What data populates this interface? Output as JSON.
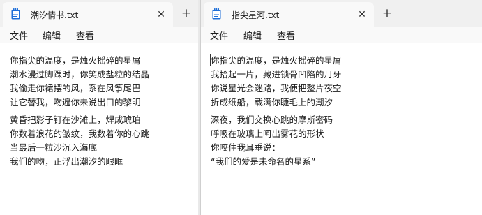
{
  "left_window": {
    "tab": {
      "title": "潮汐情书.txt"
    },
    "menu": [
      "文件",
      "编辑",
      "查看"
    ],
    "stanza1": [
      "你指尖的温度，是烛火摇碎的星屑",
      "潮水漫过脚踝时，你笑成盐粒的结晶",
      "我偷走你裙摆的风，系在风筝尾巴",
      "让它替我，吻遍你未说出口的黎明"
    ],
    "stanza2": [
      "黄昏把影子钉在沙滩上，焊成琥珀",
      "你数着浪花的皱纹，我数着你的心跳",
      "当最后一粒沙沉入海底",
      "我们的吻，正浮出潮汐的眼眶"
    ]
  },
  "right_window": {
    "tab": {
      "title": "指尖星河.txt"
    },
    "menu": [
      "文件",
      "编辑",
      "查看"
    ],
    "stanza1": [
      "你指尖的温度，是烛火摇碎的星屑",
      "我拾起一片，藏进锁骨凹陷的月牙",
      "你说星光会迷路，我便把整片夜空",
      "折成纸船，载满你睫毛上的潮汐"
    ],
    "stanza2": [
      "深夜，我们交换心跳的摩斯密码",
      "呼吸在玻璃上呵出雾花的形状",
      "你咬住我耳垂说：",
      "“我们的爱是未命名的星系”"
    ]
  },
  "colors": {
    "tabbar_bg": "#f0f0f0",
    "tab_bg": "#f9f9f9",
    "icon_blue": "#1e6fd9"
  },
  "icons": {
    "tab_icon": "notepad-icon",
    "close": "close-icon",
    "add": "plus-icon"
  }
}
